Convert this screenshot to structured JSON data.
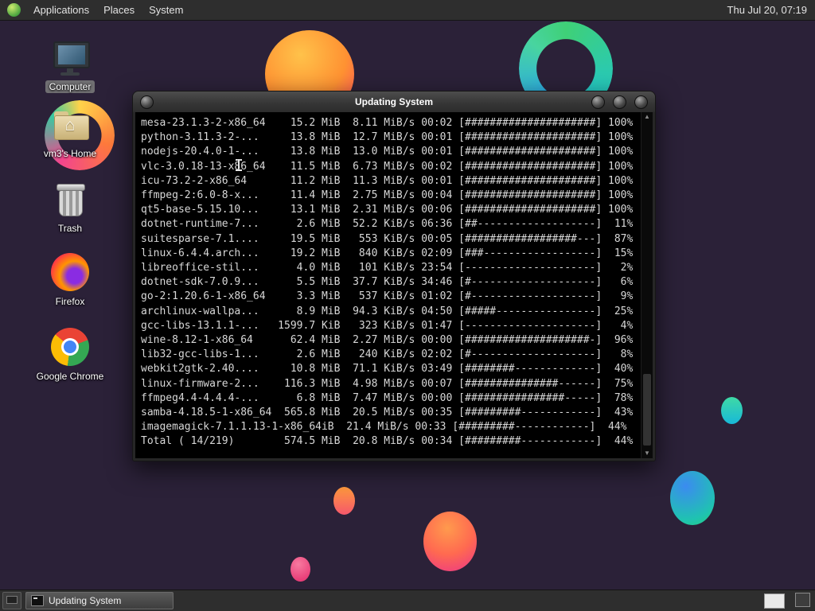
{
  "top_panel": {
    "menus": [
      {
        "label": "Applications"
      },
      {
        "label": "Places"
      },
      {
        "label": "System"
      }
    ],
    "clock": "Thu Jul 20, 07:19"
  },
  "desktop": {
    "icons": [
      {
        "label": "Computer"
      },
      {
        "label": "vm3's Home",
        "glyph": "⌂"
      },
      {
        "label": "Trash"
      },
      {
        "label": "Firefox"
      },
      {
        "label": "Google Chrome"
      }
    ]
  },
  "window": {
    "title": "Updating System",
    "scrollbar": {
      "up": "▲",
      "down": "▼"
    },
    "terminal_lines": [
      "mesa-23.1.3-2-x86_64    15.2 MiB  8.11 MiB/s 00:02 [#####################] 100%",
      "python-3.11.3-2-...     13.8 MiB  12.7 MiB/s 00:01 [#####################] 100%",
      "nodejs-20.4.0-1-...     13.8 MiB  13.0 MiB/s 00:01 [#####################] 100%",
      "vlc-3.0.18-13-x86_64    11.5 MiB  6.73 MiB/s 00:02 [#####################] 100%",
      "icu-73.2-2-x86_64       11.2 MiB  11.3 MiB/s 00:01 [#####################] 100%",
      "ffmpeg-2:6.0-8-x...     11.4 MiB  2.75 MiB/s 00:04 [#####################] 100%",
      "qt5-base-5.15.10...     13.1 MiB  2.31 MiB/s 00:06 [#####################] 100%",
      "dotnet-runtime-7...      2.6 MiB  52.2 KiB/s 06:36 [##-------------------]  11%",
      "suitesparse-7.1....     19.5 MiB   553 KiB/s 00:05 [##################---]  87%",
      "linux-6.4.4.arch...     19.2 MiB   840 KiB/s 02:09 [###------------------]  15%",
      "libreoffice-stil...      4.0 MiB   101 KiB/s 23:54 [---------------------]   2%",
      "dotnet-sdk-7.0.9...      5.5 MiB  37.7 KiB/s 34:46 [#--------------------]   6%",
      "go-2:1.20.6-1-x86_64     3.3 MiB   537 KiB/s 01:02 [#--------------------]   9%",
      "archlinux-wallpa...      8.9 MiB  94.3 KiB/s 04:50 [#####----------------]  25%",
      "gcc-libs-13.1.1-...   1599.7 KiB   323 KiB/s 01:47 [---------------------]   4%",
      "wine-8.12-1-x86_64      62.4 MiB  2.27 MiB/s 00:00 [####################-]  96%",
      "lib32-gcc-libs-1...      2.6 MiB   240 KiB/s 02:02 [#--------------------]   8%",
      "webkit2gtk-2.40....     10.8 MiB  71.1 KiB/s 03:49 [########-------------]  40%",
      "linux-firmware-2...    116.3 MiB  4.98 MiB/s 00:07 [###############------]  75%",
      "ffmpeg4.4-4.4.4-...      6.8 MiB  7.47 MiB/s 00:00 [################-----]  78%",
      "samba-4.18.5-1-x86_64  565.8 MiB  20.5 MiB/s 00:35 [#########------------]  43%",
      "imagemagick-7.1.1.13-1-x86_64iB  21.4 MiB/s 00:33 [#########------------]  44%",
      "Total ( 14/219)        574.5 MiB  20.8 MiB/s 00:34 [#########------------]  44%"
    ]
  },
  "taskbar": {
    "task_label": "Updating System"
  },
  "colors": {
    "desktop_bg": "#2b2138",
    "panel_bg": "#2e2e2e",
    "terminal_bg": "#000000",
    "terminal_fg": "#d8d8d8"
  }
}
